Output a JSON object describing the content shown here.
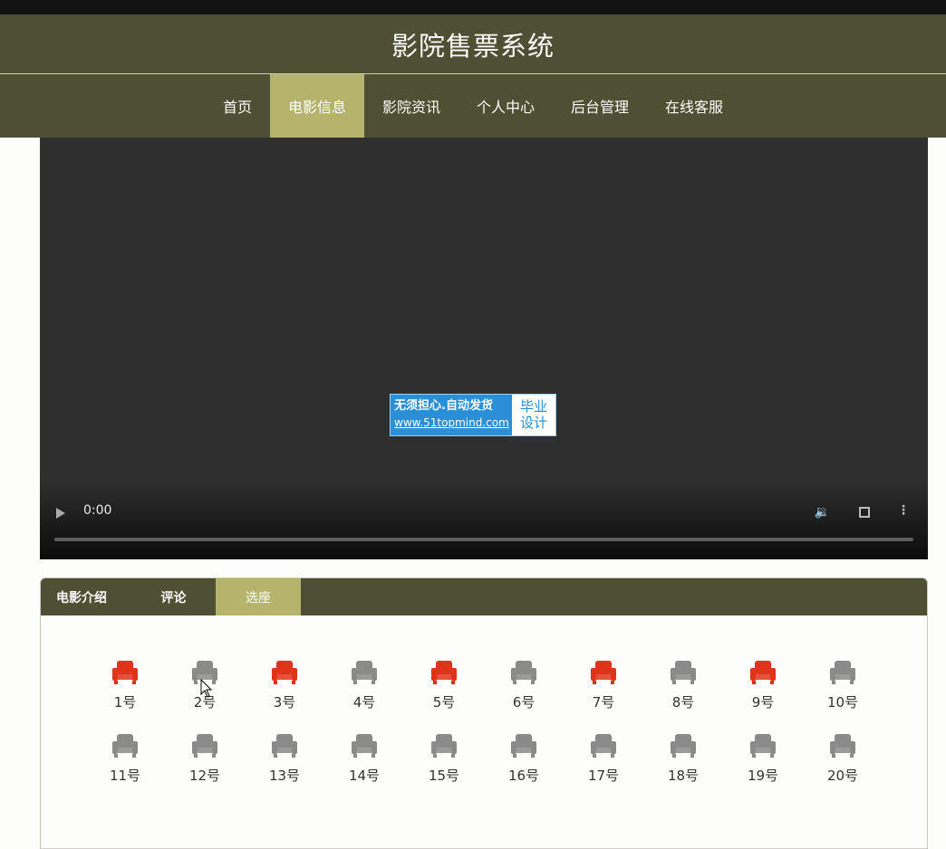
{
  "app": {
    "title": "影院售票系统"
  },
  "nav": {
    "items": [
      {
        "label": "首页"
      },
      {
        "label": "电影信息",
        "active": true
      },
      {
        "label": "影院资讯"
      },
      {
        "label": "个人中心"
      },
      {
        "label": "后台管理"
      },
      {
        "label": "在线客服"
      }
    ]
  },
  "video": {
    "time": "0:00",
    "progress": 0,
    "watermark": {
      "line1": "无须担心.自动发货",
      "line2": "www.51topmind.com",
      "badge_top": "毕业",
      "badge_bottom": "设计"
    }
  },
  "tabs": [
    {
      "label": "电影介绍"
    },
    {
      "label": "评论"
    },
    {
      "label": "选座",
      "active": true
    }
  ],
  "colors": {
    "header_bg": "#4f4f33",
    "accent": "#b6b46c",
    "seat_available": "#8a8a8a",
    "seat_taken": "#e0341a"
  },
  "seats": {
    "rows": [
      [
        {
          "label": "1号",
          "status": "taken"
        },
        {
          "label": "2号",
          "status": "available"
        },
        {
          "label": "3号",
          "status": "taken"
        },
        {
          "label": "4号",
          "status": "available"
        },
        {
          "label": "5号",
          "status": "taken"
        },
        {
          "label": "6号",
          "status": "available"
        },
        {
          "label": "7号",
          "status": "taken"
        },
        {
          "label": "8号",
          "status": "available"
        },
        {
          "label": "9号",
          "status": "taken"
        },
        {
          "label": "10号",
          "status": "available"
        }
      ],
      [
        {
          "label": "11号",
          "status": "available"
        },
        {
          "label": "12号",
          "status": "available"
        },
        {
          "label": "13号",
          "status": "available"
        },
        {
          "label": "14号",
          "status": "available"
        },
        {
          "label": "15号",
          "status": "available"
        },
        {
          "label": "16号",
          "status": "available"
        },
        {
          "label": "17号",
          "status": "available"
        },
        {
          "label": "18号",
          "status": "available"
        },
        {
          "label": "19号",
          "status": "available"
        },
        {
          "label": "20号",
          "status": "available"
        }
      ]
    ]
  }
}
